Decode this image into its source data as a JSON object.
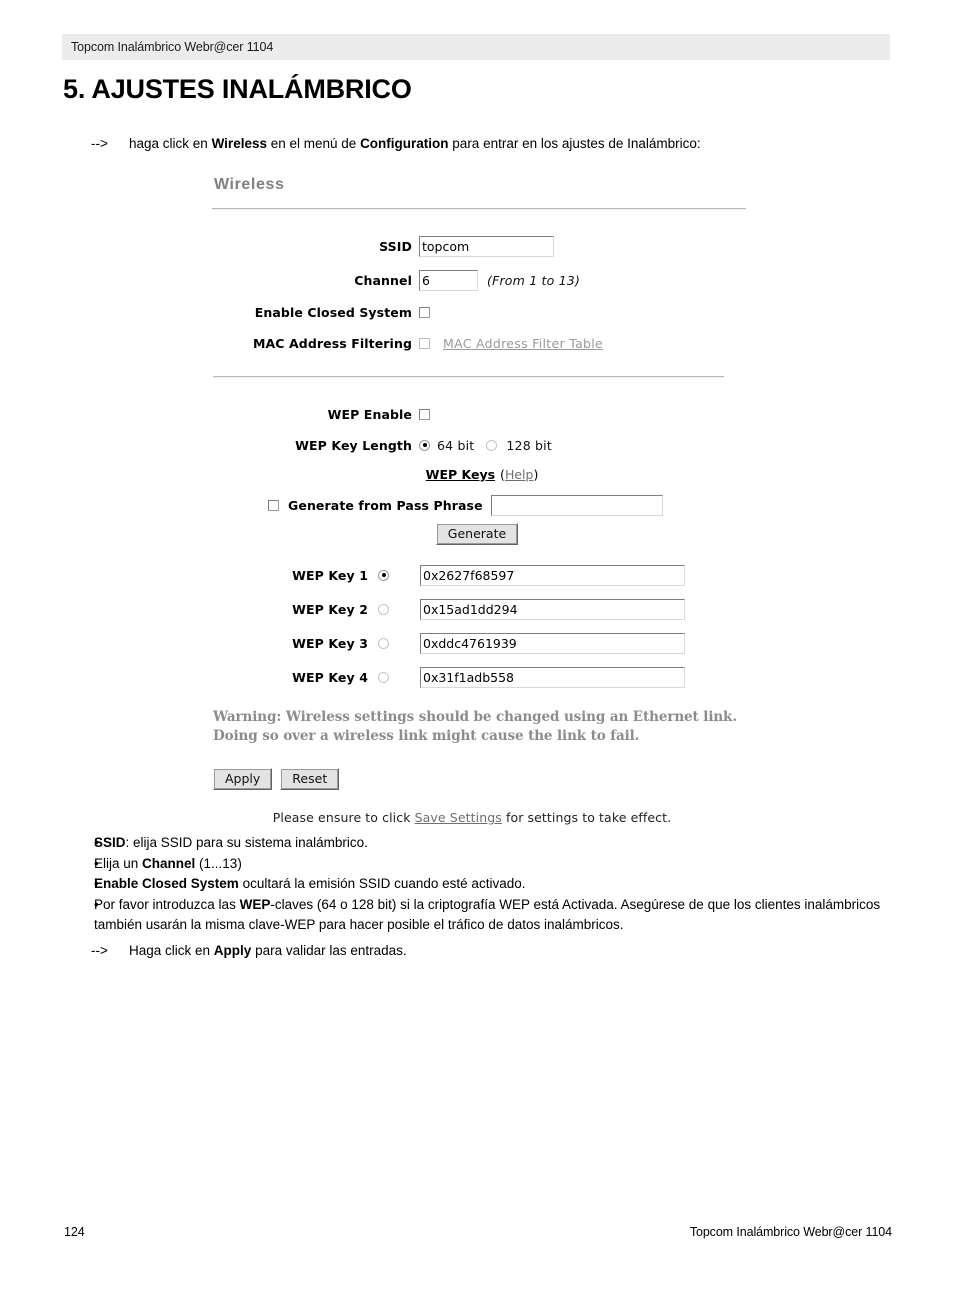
{
  "running_header": "Topcom Inalámbrico Webr@cer 1104",
  "chapter_title": "5. AJUSTES INALÁMBRICO",
  "intro": {
    "arrow": "-->",
    "part1": "haga click en ",
    "bold1": "Wireless",
    "part2": " en el menú de ",
    "bold2": "Configuration",
    "part3": " para entrar en los ajustes de Inalámbrico:"
  },
  "panel": {
    "title": "Wireless",
    "ssid": {
      "label": "SSID",
      "value": "topcom",
      "placeholder": ""
    },
    "channel": {
      "label": "Channel",
      "value": "6",
      "hint": "(From 1 to 13)",
      "placeholder": ""
    },
    "closed_system": {
      "label": "Enable Closed System",
      "checked": false
    },
    "mac_filtering": {
      "label": "MAC Address Filtering",
      "checked": false,
      "link": "MAC Address Filter Table"
    },
    "wep_enable": {
      "label": "WEP Enable",
      "checked": false
    },
    "wep_key_length": {
      "label": "WEP Key Length",
      "options": [
        {
          "label": "64 bit",
          "selected": true
        },
        {
          "label": "128 bit",
          "selected": false
        }
      ]
    },
    "wep_keys_heading": {
      "label": "WEP Keys",
      "help": "Help",
      "open_paren": "(",
      "close_paren": ")"
    },
    "passphrase": {
      "label": "Generate from Pass Phrase",
      "value": "",
      "placeholder": "",
      "checked": false,
      "generate_button": "Generate"
    },
    "wep_keys": [
      {
        "label": "WEP Key 1",
        "value": "0x2627f68597",
        "selected": true
      },
      {
        "label": "WEP Key 2",
        "value": "0x15ad1dd294",
        "selected": false
      },
      {
        "label": "WEP Key 3",
        "value": "0xddc4761939",
        "selected": false
      },
      {
        "label": "WEP Key 4",
        "value": "0x31f1adb558",
        "selected": false
      }
    ],
    "warning_line1": "Warning: Wireless settings should be changed using an Ethernet link.",
    "warning_line2": "Doing so over a wireless link might cause the link to fail.",
    "apply_button": "Apply",
    "reset_button": "Reset",
    "save_note": {
      "part1": "Please ensure to click ",
      "link": "Save Settings",
      "part2": " for settings to take effect."
    }
  },
  "bullets": [
    {
      "marker": "•",
      "bold1": "SSID",
      "text1": ": elija SSID para su sistema inalámbrico.",
      "bold2": "",
      "text2": ""
    },
    {
      "marker": "•",
      "text0": "Elija un ",
      "bold1": "Channel",
      "text1": " (1...13)",
      "bold2": "",
      "text2": ""
    },
    {
      "marker": "•",
      "bold1": "Enable Closed System",
      "text1": " ocultará la emisión SSID cuando esté activado.",
      "bold2": "",
      "text2": ""
    },
    {
      "marker": "•",
      "text0": "Por favor introduzca las ",
      "bold1": "WEP",
      "text1": "-claves (64 o 128 bit) si la criptografía WEP está Activada. Asegúrese de que los clientes inalámbricos también usarán la misma clave-WEP para hacer posible el tráfico de datos inalámbricos.",
      "bold2": "",
      "text2": ""
    }
  ],
  "closing": {
    "arrow": "-->",
    "part1": "Haga click en ",
    "bold1": "Apply",
    "part2": " para validar las entradas."
  },
  "footer": {
    "page_number": "124",
    "title": "Topcom Inalámbrico Webr@cer 1104"
  },
  "colors": {
    "header_bar": "#ececec",
    "panel_title": "#808080",
    "warning_text": "#8c8c8c",
    "link": "#6f6f6f",
    "button_face": "#e3e3e3"
  }
}
